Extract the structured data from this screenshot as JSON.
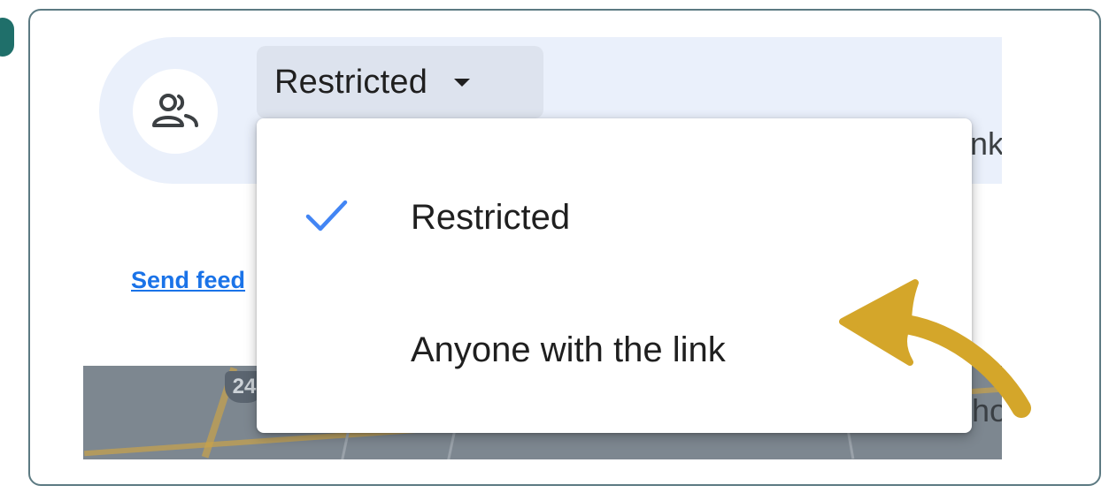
{
  "share_dialog": {
    "general_access_value": "Restricted",
    "behind_menu_text": "nk",
    "send_feedback_label": "Send feed",
    "map_shield_number": "24",
    "map_clipped_text": "ho"
  },
  "access_menu": {
    "items": [
      {
        "label": "Restricted",
        "selected": true
      },
      {
        "label": "Anyone with the link",
        "selected": false
      }
    ]
  },
  "icons": {
    "avatar": "people-icon",
    "trigger_caret": "caret-down-icon",
    "selected_marker": "check-icon",
    "annotation": "curved-arrow-icon"
  },
  "colors": {
    "frame_border": "#5c7a82",
    "accent_teal": "#1f6f6a",
    "access_bar_bg": "#eaf0fb",
    "trigger_bg": "#dde3ee",
    "check_blue": "#4285f4",
    "link_blue": "#1a73e8",
    "annotation_arrow": "#d4a62a"
  }
}
